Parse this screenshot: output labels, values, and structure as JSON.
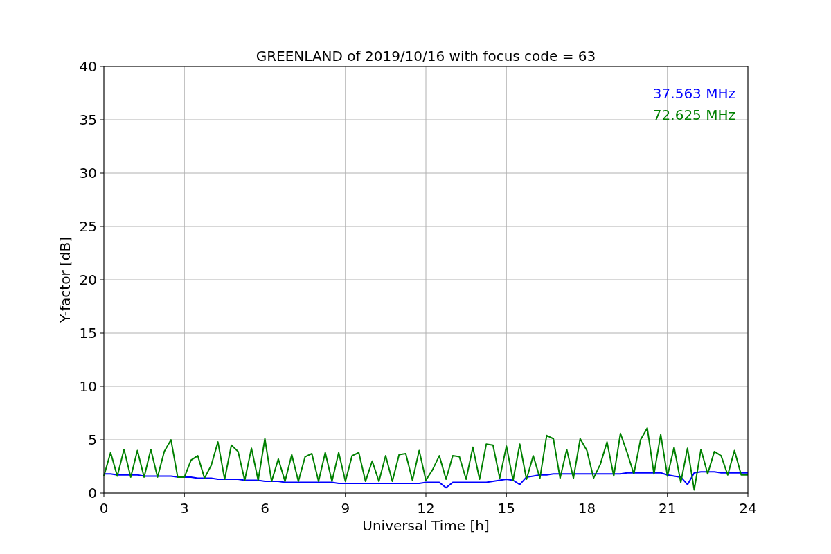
{
  "figure": {
    "chart_data": {
      "type": "line",
      "grid": true,
      "title": "GREENLAND of 2019/10/16 with focus code = 63",
      "xlabel": "Universal Time [h]",
      "ylabel": "Y-factor [dB]",
      "xlim": [
        0,
        24
      ],
      "ylim": [
        0,
        40
      ],
      "xticks": [
        0,
        3,
        6,
        9,
        12,
        15,
        18,
        21,
        24
      ],
      "yticks": [
        0,
        5,
        10,
        15,
        20,
        25,
        30,
        35,
        40
      ],
      "x": [
        0,
        0.25,
        0.5,
        0.75,
        1,
        1.25,
        1.5,
        1.75,
        2,
        2.25,
        2.5,
        2.75,
        3,
        3.25,
        3.5,
        3.75,
        4,
        4.25,
        4.5,
        4.75,
        5,
        5.25,
        5.5,
        5.75,
        6,
        6.25,
        6.5,
        6.75,
        7,
        7.25,
        7.5,
        7.75,
        8,
        8.25,
        8.5,
        8.75,
        9,
        9.25,
        9.5,
        9.75,
        10,
        10.25,
        10.5,
        10.75,
        11,
        11.25,
        11.5,
        11.75,
        12,
        12.25,
        12.5,
        12.75,
        13,
        13.25,
        13.5,
        13.75,
        14,
        14.25,
        14.5,
        14.75,
        15,
        15.25,
        15.5,
        15.75,
        16,
        16.25,
        16.5,
        16.75,
        17,
        17.25,
        17.5,
        17.75,
        18,
        18.25,
        18.5,
        18.75,
        19,
        19.25,
        19.5,
        19.75,
        20,
        20.25,
        20.5,
        20.75,
        21,
        21.25,
        21.5,
        21.75,
        22,
        22.25,
        22.5,
        22.75,
        23,
        23.25,
        23.5,
        23.75,
        24
      ],
      "series": [
        {
          "name": "37.563 MHz",
          "color": "#0000ff",
          "values": [
            1.8,
            1.8,
            1.7,
            1.7,
            1.7,
            1.7,
            1.6,
            1.6,
            1.6,
            1.6,
            1.6,
            1.5,
            1.5,
            1.5,
            1.4,
            1.4,
            1.4,
            1.3,
            1.3,
            1.3,
            1.3,
            1.2,
            1.2,
            1.2,
            1.1,
            1.1,
            1.1,
            1.0,
            1.0,
            1.0,
            1.0,
            1.0,
            1.0,
            1.0,
            1.0,
            0.9,
            0.9,
            0.9,
            0.9,
            0.9,
            0.9,
            0.9,
            0.9,
            0.9,
            0.9,
            0.9,
            0.9,
            0.9,
            1.0,
            1.0,
            1.0,
            0.5,
            1.0,
            1.0,
            1.0,
            1.0,
            1.0,
            1.0,
            1.1,
            1.2,
            1.3,
            1.2,
            0.8,
            1.5,
            1.6,
            1.7,
            1.7,
            1.8,
            1.8,
            1.8,
            1.8,
            1.8,
            1.8,
            1.8,
            1.8,
            1.8,
            1.8,
            1.8,
            1.9,
            1.9,
            1.9,
            1.9,
            1.9,
            1.9,
            1.7,
            1.6,
            1.5,
            0.8,
            1.9,
            2.0,
            2.0,
            2.0,
            1.9,
            1.9,
            1.9,
            1.9,
            1.9
          ]
        },
        {
          "name": "72.625 MHz",
          "color": "#008000",
          "values": [
            1.6,
            3.8,
            1.6,
            4.1,
            1.5,
            4.0,
            1.5,
            4.1,
            1.5,
            3.9,
            5.0,
            1.5,
            1.5,
            3.1,
            3.5,
            1.4,
            2.6,
            4.8,
            1.3,
            4.5,
            3.9,
            1.2,
            4.2,
            1.2,
            5.1,
            1.1,
            3.2,
            1.1,
            3.6,
            1.1,
            3.4,
            3.7,
            1.1,
            3.8,
            1.1,
            3.8,
            1.1,
            3.5,
            3.8,
            1.1,
            3.0,
            1.1,
            3.5,
            1.1,
            3.6,
            3.7,
            1.2,
            4.0,
            1.2,
            2.2,
            3.5,
            1.3,
            3.5,
            3.4,
            1.3,
            4.3,
            1.3,
            4.6,
            4.5,
            1.4,
            4.4,
            1.2,
            4.6,
            1.3,
            3.5,
            1.4,
            5.4,
            5.1,
            1.4,
            4.1,
            1.4,
            5.1,
            4.0,
            1.4,
            2.7,
            4.8,
            1.6,
            5.6,
            3.8,
            1.8,
            5.0,
            6.1,
            1.8,
            5.5,
            1.6,
            4.3,
            1.0,
            4.2,
            0.3,
            4.1,
            1.8,
            3.9,
            3.5,
            1.7,
            4.0,
            1.7,
            1.7
          ]
        }
      ]
    }
  }
}
